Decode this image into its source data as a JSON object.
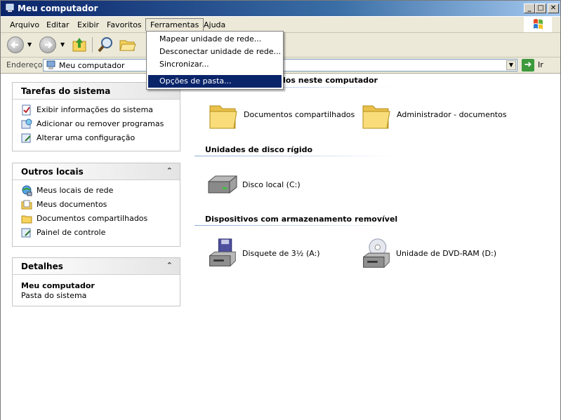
{
  "window": {
    "title": "Meu computador"
  },
  "menubar": {
    "items": [
      "Arquivo",
      "Editar",
      "Exibir",
      "Favoritos",
      "Ferramentas",
      "Ajuda"
    ]
  },
  "tools_menu": {
    "items": [
      "Mapear unidade de rede...",
      "Desconectar unidade de rede...",
      "Sincronizar...",
      "Opções de pasta..."
    ],
    "highlighted_index": 3
  },
  "address": {
    "label": "Endereço",
    "value": "Meu computador",
    "go_label": "Ir"
  },
  "panels": {
    "tasks": {
      "title": "Tarefas do sistema",
      "links": [
        "Exibir informações do sistema",
        "Adicionar ou remover programas",
        "Alterar uma configuração"
      ]
    },
    "other": {
      "title": "Outros locais",
      "links": [
        "Meus locais de rede",
        "Meus documentos",
        "Documentos compartilhados",
        "Painel de controle"
      ]
    },
    "details": {
      "title": "Detalhes",
      "name": "Meu computador",
      "desc": "Pasta do sistema"
    }
  },
  "sections": {
    "stored": {
      "title_fragment": "dos neste computador",
      "items": [
        "Documentos compartilhados",
        "Administrador - documentos"
      ]
    },
    "hard_disks": {
      "title": "Unidades de disco rígido",
      "items": [
        "Disco local (C:)"
      ]
    },
    "removable": {
      "title": "Dispositivos com armazenamento removível",
      "items": [
        "Disquete de 3½ (A:)",
        "Unidade de DVD-RAM (D:)"
      ]
    }
  },
  "colors": {
    "title_bar": "#0a246a",
    "highlight": "#0a246a",
    "menu_bg": "#ece9d8",
    "section_line": "#8eacd8"
  }
}
